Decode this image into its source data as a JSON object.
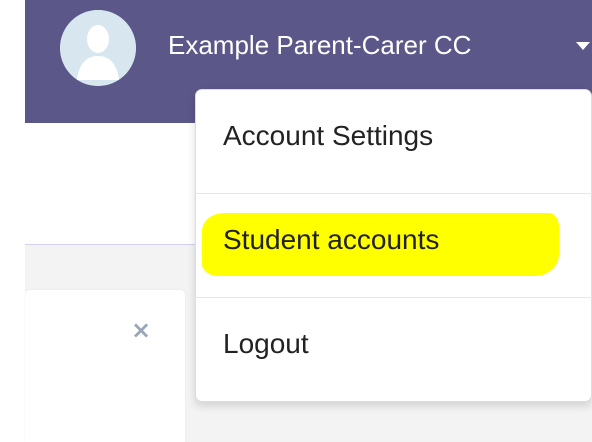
{
  "header": {
    "user_name": "Example Parent-Carer CC"
  },
  "menu": {
    "items": [
      {
        "label": "Account Settings"
      },
      {
        "label": "Student accounts",
        "highlighted": true
      },
      {
        "label": "Logout"
      }
    ]
  },
  "panel": {
    "close_symbol": "×"
  },
  "icons": {
    "avatar": "user-avatar-icon",
    "caret": "caret-down-icon",
    "close": "close-icon"
  },
  "colors": {
    "header_bg": "#5b5788",
    "highlight": "#ffff00",
    "close_icon": "#9aa7b8"
  }
}
